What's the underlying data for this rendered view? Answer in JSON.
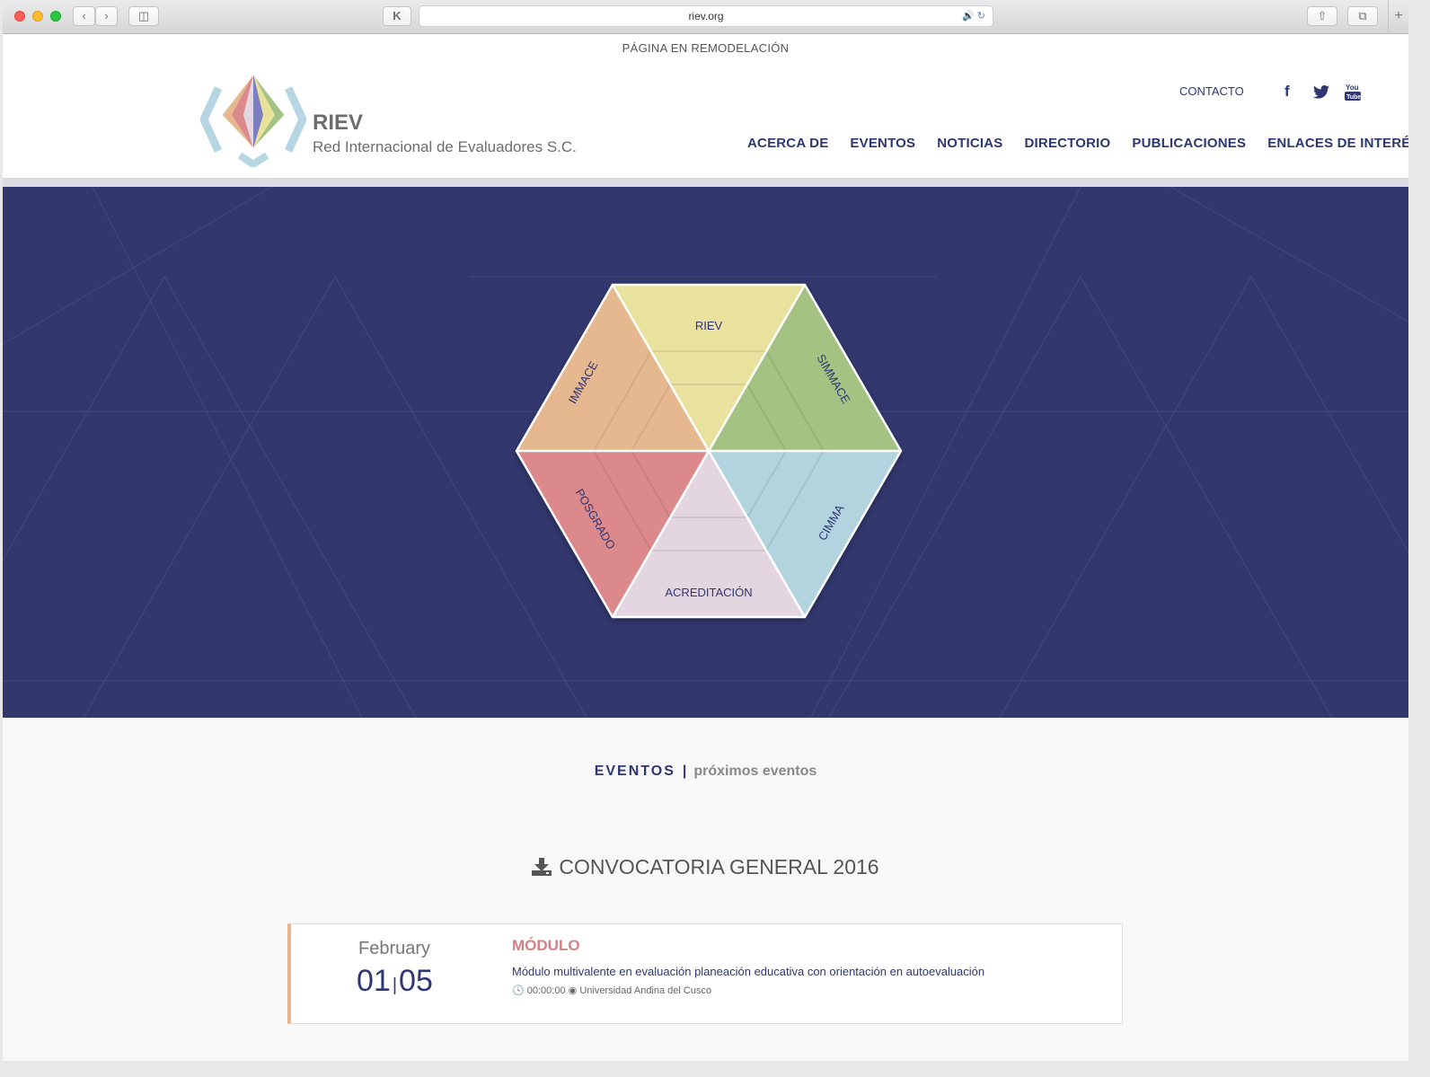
{
  "browser": {
    "url": "riev.org"
  },
  "notice": "PÁGINA EN REMODELACIÓN",
  "logo": {
    "title": "RIEV",
    "subtitle": "Red Internacional de Evaluadores S.C."
  },
  "topbar": {
    "contact": "CONTACTO",
    "social": [
      "facebook-icon",
      "twitter-icon",
      "youtube-icon"
    ]
  },
  "nav": [
    "ACERCA DE",
    "EVENTOS",
    "NOTICIAS",
    "DIRECTORIO",
    "PUBLICACIONES",
    "ENLACES DE INTERÉS"
  ],
  "hexagon": {
    "segments": [
      "RIEV",
      "SIMMACE",
      "CIMMA",
      "ACREDITACIÓN",
      "POSGRADO",
      "IMMACE"
    ],
    "colors": [
      "#e9e19e",
      "#a4c281",
      "#b1d4de",
      "#e3d6e0",
      "#dc898c",
      "#e6b88f"
    ]
  },
  "events_section": {
    "title": "EVENTOS",
    "subtitle": "próximos eventos",
    "download_title": "CONVOCATORIA GENERAL 2016",
    "items": [
      {
        "month": "February",
        "day_start": "01",
        "day_end": "05",
        "type": "MÓDULO",
        "title": "Módulo multivalente en evaluación planeación educativa con orientación en autoevaluación",
        "time": "00:00:00",
        "location": "Universidad Andina del Cusco"
      }
    ]
  },
  "colors": {
    "brand": "#2f3672",
    "hero_bg": "#32376d",
    "accent": "#d48185"
  }
}
